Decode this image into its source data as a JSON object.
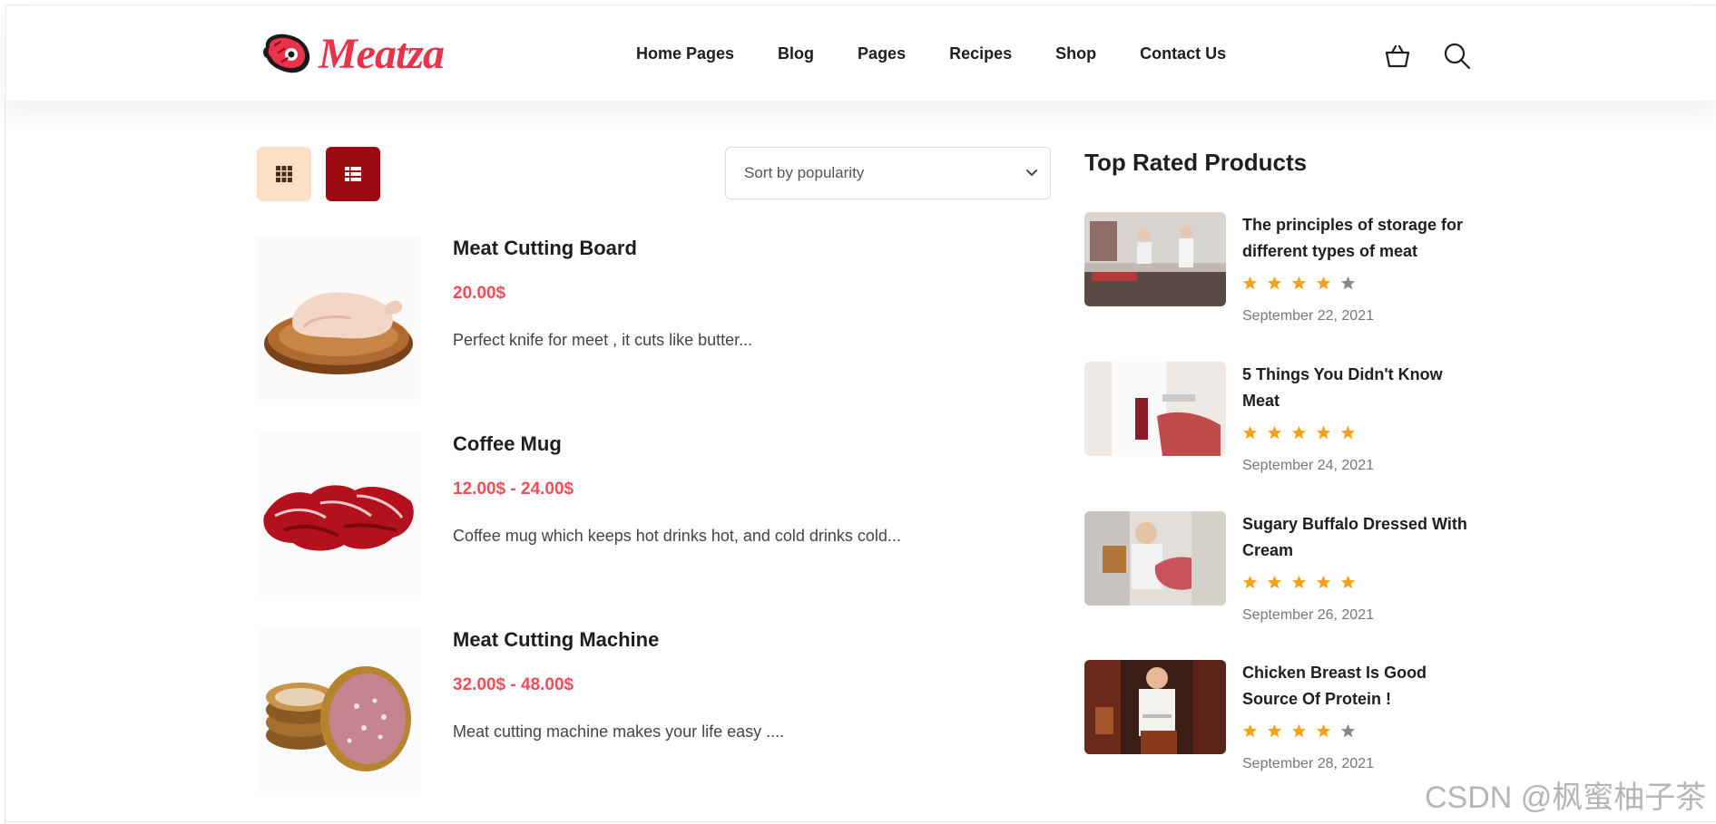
{
  "header": {
    "logo_text": "Meatza",
    "nav": [
      "Home Pages",
      "Blog",
      "Pages",
      "Recipes",
      "Shop",
      "Contact Us"
    ],
    "icons": [
      "cart-icon",
      "search-icon"
    ]
  },
  "toolbar": {
    "view_icons": [
      "grid-view-icon",
      "list-view-icon"
    ],
    "sort_selected": "Sort by popularity"
  },
  "products": [
    {
      "title": "Meat Cutting Board",
      "price": "20.00$",
      "description": "Perfect knife for meet , it cuts like butter..."
    },
    {
      "title": "Coffee Mug",
      "price": "12.00$ - 24.00$",
      "description": "Coffee mug which keeps hot drinks hot, and cold drinks cold..."
    },
    {
      "title": "Meat Cutting Machine",
      "price": "32.00$ - 48.00$",
      "description": "Meat cutting machine makes your life easy ...."
    }
  ],
  "sidebar": {
    "title": "Top Rated Products",
    "items": [
      {
        "title": "The principles of storage for different types of meat",
        "rating": 4,
        "date": "September 22, 2021"
      },
      {
        "title": "5 Things You Didn't Know Meat",
        "rating": 5,
        "date": "September 24, 2021"
      },
      {
        "title": "Sugary Buffalo Dressed With Cream",
        "rating": 5,
        "date": "September 26, 2021"
      },
      {
        "title": "Chicken Breast Is Good Source Of Protein !",
        "rating": 4,
        "date": "September 28, 2021"
      }
    ]
  },
  "colors": {
    "accent": "#e9334a",
    "price": "#ee4f56",
    "dark_red": "#9c0a12",
    "peach": "#fde1c6",
    "star_on": "#f5a11c",
    "star_off": "#888888"
  },
  "watermark": "CSDN @枫蜜柚子茶"
}
